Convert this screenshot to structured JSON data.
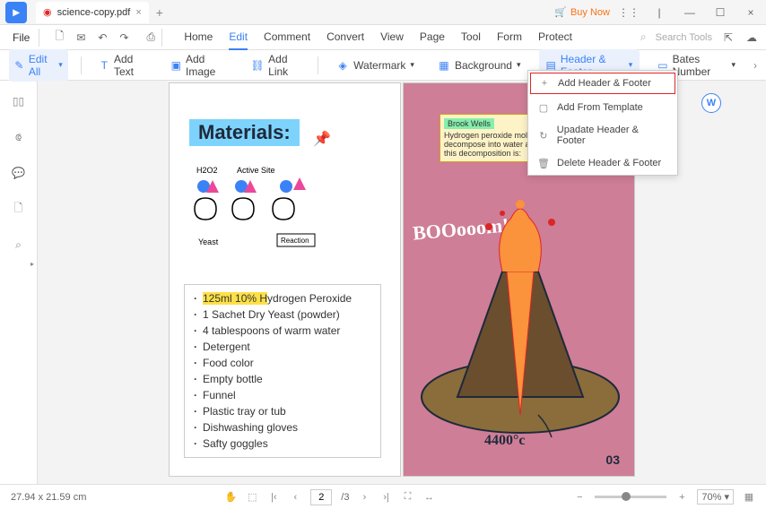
{
  "titlebar": {
    "filename": "science-copy.pdf",
    "buy_now": "Buy Now"
  },
  "menubar": {
    "file": "File",
    "tabs": [
      "Home",
      "Edit",
      "Comment",
      "Convert",
      "View",
      "Page",
      "Tool",
      "Form",
      "Protect"
    ],
    "active_tab": "Edit",
    "search_placeholder": "Search Tools"
  },
  "toolbar": {
    "edit_all": "Edit All",
    "add_text": "Add Text",
    "add_image": "Add Image",
    "add_link": "Add Link",
    "watermark": "Watermark",
    "background": "Background",
    "header_footer": "Header & Footer",
    "bates_number": "Bates Number"
  },
  "dropdown": {
    "items": [
      "Add Header & Footer",
      "Add From Template",
      "Upadate Header & Footer",
      "Delete Header & Footer"
    ]
  },
  "page_left": {
    "title": "Materials:",
    "diagram_labels": {
      "h2o2": "H2O2",
      "active_site": "Active Site",
      "yeast": "Yeast",
      "reaction": "Reaction"
    },
    "list": [
      "125ml 10% Hydrogen Peroxide",
      "1 Sachet Dry Yeast (powder)",
      "4 tablespoons of warm water",
      "Detergent",
      "Food color",
      "Empty bottle",
      "Funnel",
      "Plastic tray or tub",
      "Dishwashing gloves",
      "Safty goggles"
    ]
  },
  "page_right": {
    "note_author": "Brook Wells",
    "note_text": "Hydrogen peroxide molecules and naturally decompose into water and... The chemical equation for this decomposition is:",
    "boom": "BOOooom!",
    "temp": "4400°c",
    "page_num": "03"
  },
  "statusbar": {
    "dimensions": "27.94 x 21.59 cm",
    "current_page": "2",
    "total_pages": "/3",
    "zoom": "70%"
  }
}
